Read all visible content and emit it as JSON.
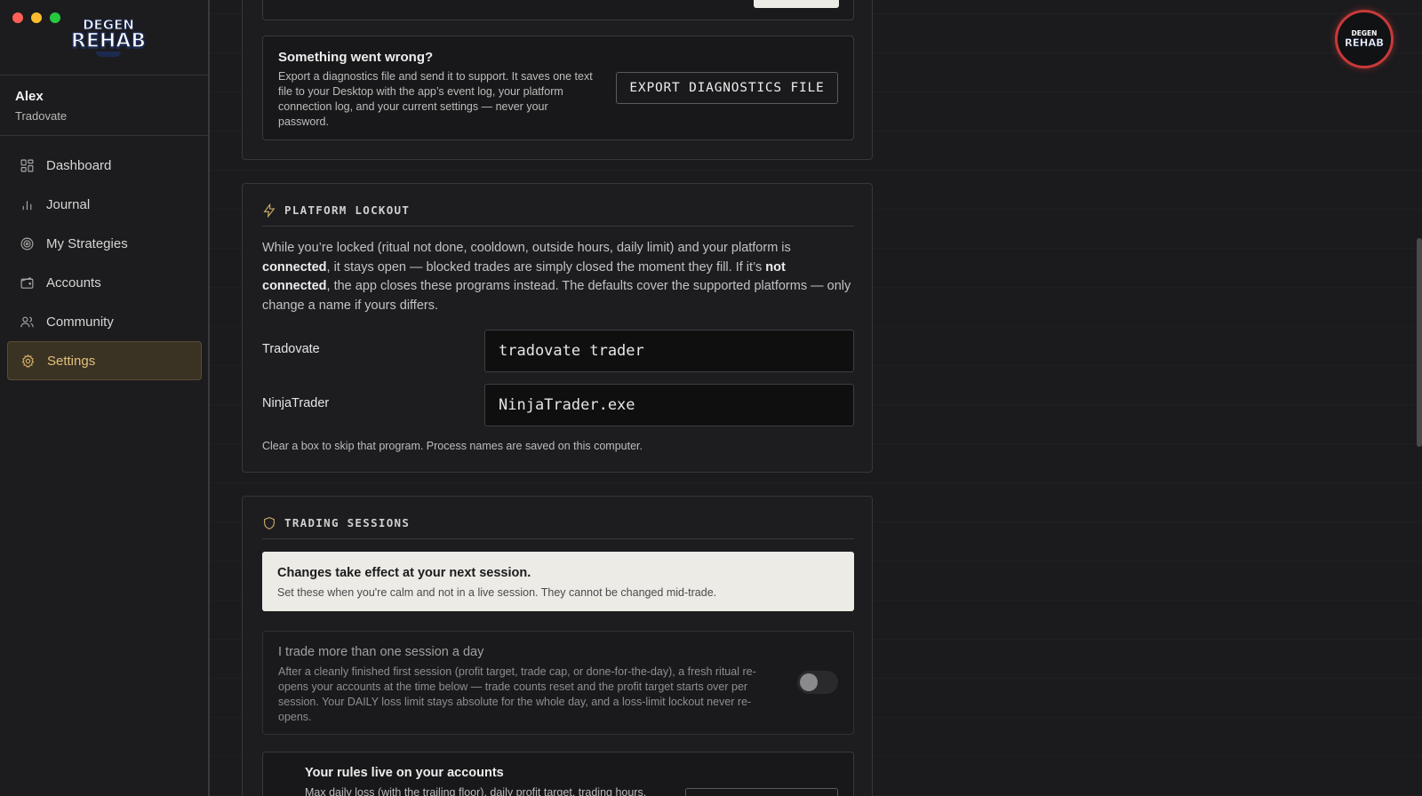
{
  "brand": {
    "logo_line1": "DEGEN",
    "logo_line2": "REHAB"
  },
  "user": {
    "name": "Alex",
    "platform": "Tradovate"
  },
  "nav": {
    "items": [
      {
        "label": "Dashboard",
        "icon": "dashboard-icon"
      },
      {
        "label": "Journal",
        "icon": "bar-chart-icon"
      },
      {
        "label": "My Strategies",
        "icon": "target-icon"
      },
      {
        "label": "Accounts",
        "icon": "wallet-icon"
      },
      {
        "label": "Community",
        "icon": "users-icon"
      },
      {
        "label": "Settings",
        "icon": "gear-icon"
      }
    ],
    "active": "Settings"
  },
  "diagnostics": {
    "title": "Something went wrong?",
    "description": "Export a diagnostics file and send it to support. It saves one text file to your Desktop with the app’s event log, your platform connection log, and your current settings — never your password.",
    "button_label": "EXPORT DIAGNOSTICS FILE"
  },
  "platform_lockout": {
    "heading": "PLATFORM LOCKOUT",
    "text_1": "While you’re locked (ritual not done, cooldown, outside hours, daily limit) and your platform is ",
    "bold_1": "connected",
    "text_2": ", it stays open — blocked trades are simply closed the moment they fill. If it’s ",
    "bold_2": "not connected",
    "text_3": ", the app closes these programs instead. The defaults cover the supported platforms — only change a name if yours differs.",
    "fields": [
      {
        "label": "Tradovate",
        "value": "tradovate trader"
      },
      {
        "label": "NinjaTrader",
        "value": "NinjaTrader.exe"
      }
    ],
    "hint": "Clear a box to skip that program. Process names are saved on this computer."
  },
  "trading_sessions": {
    "heading": "TRADING SESSIONS",
    "notice_title": "Changes take effect at your next session.",
    "notice_sub": "Set these when you're calm and not in a live session. They cannot be changed mid-trade.",
    "multi_session": {
      "title": "I trade more than one session a day",
      "description": "After a cleanly finished first session (profit target, trade cap, or done-for-the-day), a fresh ritual re-opens your accounts at the time below — trade counts reset and the profit target starts over per session. Your DAILY loss limit stays absolute for the whole day, and a loss-limit lockout never re-opens.",
      "enabled": false
    },
    "rules": {
      "title": "Your rules live on your accounts",
      "description": "Max daily loss (with the trailing floor), daily profit target, trading hours,"
    }
  },
  "colors": {
    "accent": "#d9b46a",
    "avatar_ring": "#c8393a",
    "background": "#1b1b1d"
  }
}
